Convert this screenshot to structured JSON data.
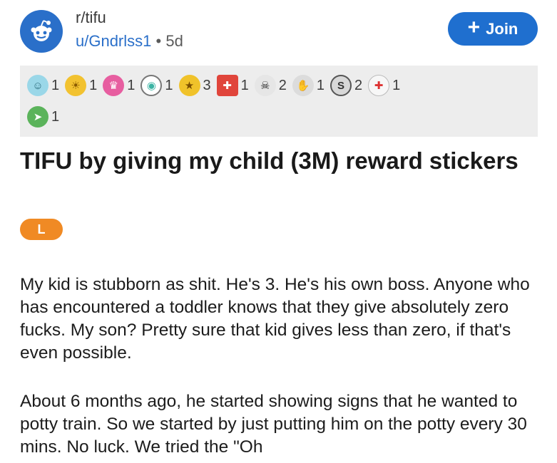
{
  "post": {
    "subreddit": "r/tifu",
    "author": "u/Gndrlss1",
    "separator": "•",
    "age": "5d",
    "title": "TIFU by giving my child (3M) reward stickers",
    "flair": "L",
    "paragraphs": [
      "My kid is stubborn as shit. He's 3. He's his own boss. Anyone who has encountered a toddler knows that they give absolutely zero fucks. My son? Pretty sure that kid gives less than zero, if that's even possible.",
      "About 6 months ago, he started showing signs that he wanted to potty train. So we started by just putting him on the potty every 30 mins. No luck. We tried the \"Oh"
    ]
  },
  "join_button": {
    "icon": "plus",
    "label": "Join"
  },
  "awards": [
    {
      "icon": "wholesome-award-icon",
      "glyph": "☺",
      "color": "#9ad7e8",
      "count": "1"
    },
    {
      "icon": "sun-award-icon",
      "glyph": "☀",
      "color": "#f2c230",
      "count": "1"
    },
    {
      "icon": "crowned-face-award-icon",
      "glyph": "♛",
      "color": "#e75ea0",
      "count": "1"
    },
    {
      "icon": "shield-award-icon",
      "glyph": "◉",
      "color": "#5fc9b8",
      "count": "1"
    },
    {
      "icon": "star-badge-award-icon",
      "glyph": "★",
      "color": "#f0c22a",
      "count": "3"
    },
    {
      "icon": "gift-award-icon",
      "glyph": "✚",
      "color": "#e0453b",
      "count": "1"
    },
    {
      "icon": "skull-award-icon",
      "glyph": "☠",
      "color": "#d8d8d8",
      "count": "2"
    },
    {
      "icon": "handshake-award-icon",
      "glyph": "✋",
      "color": "#d5d5d5",
      "count": "1"
    },
    {
      "icon": "silver-coin-award-icon",
      "glyph": "S",
      "color": "#cfcfcf",
      "count": "2"
    },
    {
      "icon": "doctor-award-icon",
      "glyph": "✚",
      "color": "#f3f3f3",
      "count": "1"
    },
    {
      "icon": "snake-award-icon",
      "glyph": "➤",
      "color": "#5bb35b",
      "count": "1"
    }
  ]
}
